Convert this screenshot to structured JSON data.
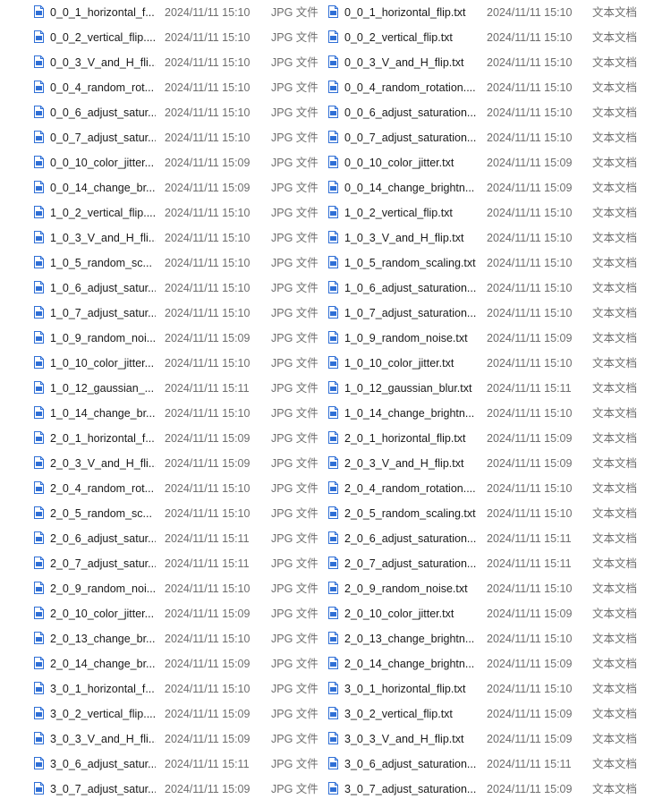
{
  "icons": {
    "jpg": "image-file-icon",
    "txt": "text-file-icon"
  },
  "colors": {
    "icon_blue": "#2f6fd6",
    "secondary_text": "#6d6d6d"
  },
  "rows": [
    {
      "jpg_name": "0_0_1_horizontal_f...",
      "jpg_date": "2024/11/11 15:10",
      "jpg_type": "JPG 文件",
      "txt_name": "0_0_1_horizontal_flip.txt",
      "txt_date": "2024/11/11 15:10",
      "txt_type": "文本文档"
    },
    {
      "jpg_name": "0_0_2_vertical_flip....",
      "jpg_date": "2024/11/11 15:10",
      "jpg_type": "JPG 文件",
      "txt_name": "0_0_2_vertical_flip.txt",
      "txt_date": "2024/11/11 15:10",
      "txt_type": "文本文档"
    },
    {
      "jpg_name": "0_0_3_V_and_H_fli...",
      "jpg_date": "2024/11/11 15:10",
      "jpg_type": "JPG 文件",
      "txt_name": "0_0_3_V_and_H_flip.txt",
      "txt_date": "2024/11/11 15:10",
      "txt_type": "文本文档"
    },
    {
      "jpg_name": "0_0_4_random_rot...",
      "jpg_date": "2024/11/11 15:10",
      "jpg_type": "JPG 文件",
      "txt_name": "0_0_4_random_rotation....",
      "txt_date": "2024/11/11 15:10",
      "txt_type": "文本文档"
    },
    {
      "jpg_name": "0_0_6_adjust_satur...",
      "jpg_date": "2024/11/11 15:10",
      "jpg_type": "JPG 文件",
      "txt_name": "0_0_6_adjust_saturation...",
      "txt_date": "2024/11/11 15:10",
      "txt_type": "文本文档"
    },
    {
      "jpg_name": "0_0_7_adjust_satur...",
      "jpg_date": "2024/11/11 15:10",
      "jpg_type": "JPG 文件",
      "txt_name": "0_0_7_adjust_saturation...",
      "txt_date": "2024/11/11 15:10",
      "txt_type": "文本文档"
    },
    {
      "jpg_name": "0_0_10_color_jitter...",
      "jpg_date": "2024/11/11 15:09",
      "jpg_type": "JPG 文件",
      "txt_name": "0_0_10_color_jitter.txt",
      "txt_date": "2024/11/11 15:09",
      "txt_type": "文本文档"
    },
    {
      "jpg_name": "0_0_14_change_br...",
      "jpg_date": "2024/11/11 15:09",
      "jpg_type": "JPG 文件",
      "txt_name": "0_0_14_change_brightn...",
      "txt_date": "2024/11/11 15:09",
      "txt_type": "文本文档"
    },
    {
      "jpg_name": "1_0_2_vertical_flip....",
      "jpg_date": "2024/11/11 15:10",
      "jpg_type": "JPG 文件",
      "txt_name": "1_0_2_vertical_flip.txt",
      "txt_date": "2024/11/11 15:10",
      "txt_type": "文本文档"
    },
    {
      "jpg_name": "1_0_3_V_and_H_fli...",
      "jpg_date": "2024/11/11 15:10",
      "jpg_type": "JPG 文件",
      "txt_name": "1_0_3_V_and_H_flip.txt",
      "txt_date": "2024/11/11 15:10",
      "txt_type": "文本文档"
    },
    {
      "jpg_name": "1_0_5_random_sc...",
      "jpg_date": "2024/11/11 15:10",
      "jpg_type": "JPG 文件",
      "txt_name": "1_0_5_random_scaling.txt",
      "txt_date": "2024/11/11 15:10",
      "txt_type": "文本文档"
    },
    {
      "jpg_name": "1_0_6_adjust_satur...",
      "jpg_date": "2024/11/11 15:10",
      "jpg_type": "JPG 文件",
      "txt_name": "1_0_6_adjust_saturation...",
      "txt_date": "2024/11/11 15:10",
      "txt_type": "文本文档"
    },
    {
      "jpg_name": "1_0_7_adjust_satur...",
      "jpg_date": "2024/11/11 15:10",
      "jpg_type": "JPG 文件",
      "txt_name": "1_0_7_adjust_saturation...",
      "txt_date": "2024/11/11 15:10",
      "txt_type": "文本文档"
    },
    {
      "jpg_name": "1_0_9_random_noi...",
      "jpg_date": "2024/11/11 15:09",
      "jpg_type": "JPG 文件",
      "txt_name": "1_0_9_random_noise.txt",
      "txt_date": "2024/11/11 15:09",
      "txt_type": "文本文档"
    },
    {
      "jpg_name": "1_0_10_color_jitter...",
      "jpg_date": "2024/11/11 15:10",
      "jpg_type": "JPG 文件",
      "txt_name": "1_0_10_color_jitter.txt",
      "txt_date": "2024/11/11 15:10",
      "txt_type": "文本文档"
    },
    {
      "jpg_name": "1_0_12_gaussian_...",
      "jpg_date": "2024/11/11 15:11",
      "jpg_type": "JPG 文件",
      "txt_name": "1_0_12_gaussian_blur.txt",
      "txt_date": "2024/11/11 15:11",
      "txt_type": "文本文档"
    },
    {
      "jpg_name": "1_0_14_change_br...",
      "jpg_date": "2024/11/11 15:10",
      "jpg_type": "JPG 文件",
      "txt_name": "1_0_14_change_brightn...",
      "txt_date": "2024/11/11 15:10",
      "txt_type": "文本文档"
    },
    {
      "jpg_name": "2_0_1_horizontal_f...",
      "jpg_date": "2024/11/11 15:09",
      "jpg_type": "JPG 文件",
      "txt_name": "2_0_1_horizontal_flip.txt",
      "txt_date": "2024/11/11 15:09",
      "txt_type": "文本文档"
    },
    {
      "jpg_name": "2_0_3_V_and_H_fli...",
      "jpg_date": "2024/11/11 15:09",
      "jpg_type": "JPG 文件",
      "txt_name": "2_0_3_V_and_H_flip.txt",
      "txt_date": "2024/11/11 15:09",
      "txt_type": "文本文档"
    },
    {
      "jpg_name": "2_0_4_random_rot...",
      "jpg_date": "2024/11/11 15:10",
      "jpg_type": "JPG 文件",
      "txt_name": "2_0_4_random_rotation....",
      "txt_date": "2024/11/11 15:10",
      "txt_type": "文本文档"
    },
    {
      "jpg_name": "2_0_5_random_sc...",
      "jpg_date": "2024/11/11 15:10",
      "jpg_type": "JPG 文件",
      "txt_name": "2_0_5_random_scaling.txt",
      "txt_date": "2024/11/11 15:10",
      "txt_type": "文本文档"
    },
    {
      "jpg_name": "2_0_6_adjust_satur...",
      "jpg_date": "2024/11/11 15:11",
      "jpg_type": "JPG 文件",
      "txt_name": "2_0_6_adjust_saturation...",
      "txt_date": "2024/11/11 15:11",
      "txt_type": "文本文档"
    },
    {
      "jpg_name": "2_0_7_adjust_satur...",
      "jpg_date": "2024/11/11 15:11",
      "jpg_type": "JPG 文件",
      "txt_name": "2_0_7_adjust_saturation...",
      "txt_date": "2024/11/11 15:11",
      "txt_type": "文本文档"
    },
    {
      "jpg_name": "2_0_9_random_noi...",
      "jpg_date": "2024/11/11 15:10",
      "jpg_type": "JPG 文件",
      "txt_name": "2_0_9_random_noise.txt",
      "txt_date": "2024/11/11 15:10",
      "txt_type": "文本文档"
    },
    {
      "jpg_name": "2_0_10_color_jitter...",
      "jpg_date": "2024/11/11 15:09",
      "jpg_type": "JPG 文件",
      "txt_name": "2_0_10_color_jitter.txt",
      "txt_date": "2024/11/11 15:09",
      "txt_type": "文本文档"
    },
    {
      "jpg_name": "2_0_13_change_br...",
      "jpg_date": "2024/11/11 15:10",
      "jpg_type": "JPG 文件",
      "txt_name": "2_0_13_change_brightn...",
      "txt_date": "2024/11/11 15:10",
      "txt_type": "文本文档"
    },
    {
      "jpg_name": "2_0_14_change_br...",
      "jpg_date": "2024/11/11 15:09",
      "jpg_type": "JPG 文件",
      "txt_name": "2_0_14_change_brightn...",
      "txt_date": "2024/11/11 15:09",
      "txt_type": "文本文档"
    },
    {
      "jpg_name": "3_0_1_horizontal_f...",
      "jpg_date": "2024/11/11 15:10",
      "jpg_type": "JPG 文件",
      "txt_name": "3_0_1_horizontal_flip.txt",
      "txt_date": "2024/11/11 15:10",
      "txt_type": "文本文档"
    },
    {
      "jpg_name": "3_0_2_vertical_flip....",
      "jpg_date": "2024/11/11 15:09",
      "jpg_type": "JPG 文件",
      "txt_name": "3_0_2_vertical_flip.txt",
      "txt_date": "2024/11/11 15:09",
      "txt_type": "文本文档"
    },
    {
      "jpg_name": "3_0_3_V_and_H_fli...",
      "jpg_date": "2024/11/11 15:09",
      "jpg_type": "JPG 文件",
      "txt_name": "3_0_3_V_and_H_flip.txt",
      "txt_date": "2024/11/11 15:09",
      "txt_type": "文本文档"
    },
    {
      "jpg_name": "3_0_6_adjust_satur...",
      "jpg_date": "2024/11/11 15:11",
      "jpg_type": "JPG 文件",
      "txt_name": "3_0_6_adjust_saturation...",
      "txt_date": "2024/11/11 15:11",
      "txt_type": "文本文档"
    },
    {
      "jpg_name": "3_0_7_adjust_satur...",
      "jpg_date": "2024/11/11 15:09",
      "jpg_type": "JPG 文件",
      "txt_name": "3_0_7_adjust_saturation...",
      "txt_date": "2024/11/11 15:09",
      "txt_type": "文本文档"
    }
  ]
}
